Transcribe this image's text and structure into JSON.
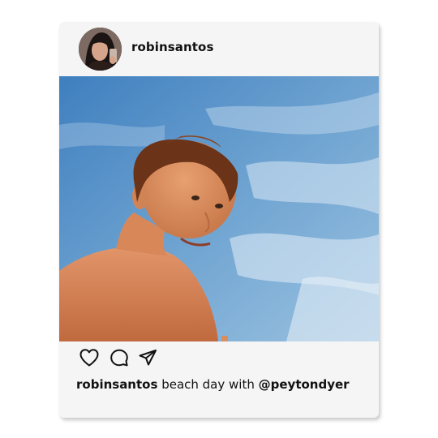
{
  "post": {
    "username": "robinsantos",
    "caption": {
      "username": "robinsantos",
      "text": "beach day with",
      "mention": "@peytondyer"
    },
    "actions": [
      {
        "name": "like",
        "icon": "heart-icon"
      },
      {
        "name": "comment",
        "icon": "comment-icon"
      },
      {
        "name": "share",
        "icon": "send-icon"
      }
    ]
  },
  "colors": {
    "card_background": "#f5f5f5",
    "page_background": "#ffffff",
    "text": "#111111",
    "sky": "#5a93c6"
  }
}
